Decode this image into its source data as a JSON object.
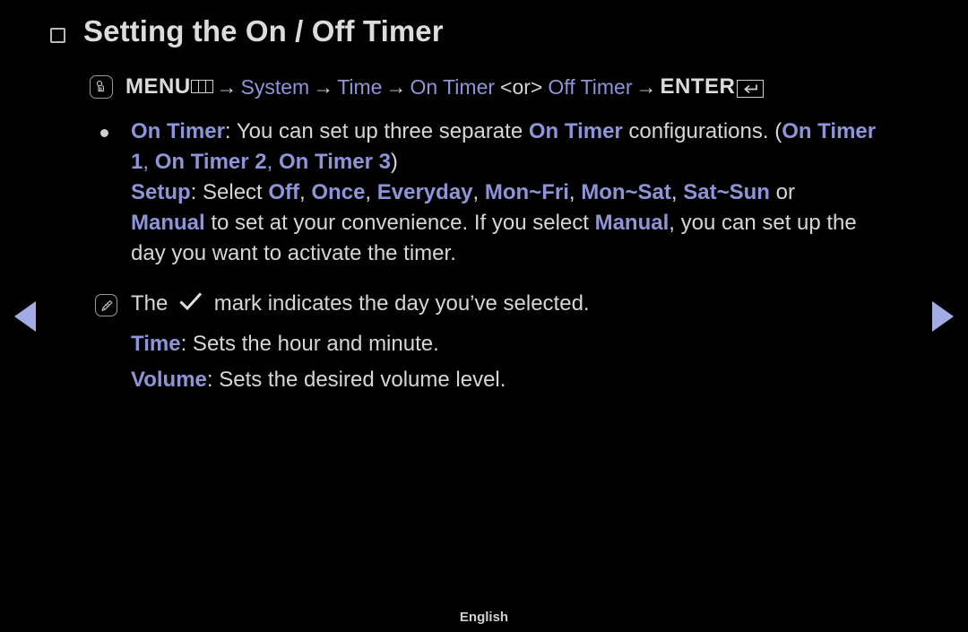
{
  "page": {
    "title": "Setting the On / Off Timer",
    "title_bullet_icon": "square-bullet-icon",
    "background_color": "#000000",
    "accent_color": "#8e94d8",
    "text_color": "#d6d6d6",
    "nav_arrow_color": "#a3abe4"
  },
  "breadcrumb": {
    "menu_icon": "hand-press-icon",
    "menu_label": "MENU",
    "arrow": "→",
    "items": [
      "System",
      "Time",
      "On Timer",
      "Off Timer"
    ],
    "or_label": "<or>",
    "enter_label": "ENTER",
    "enter_icon": "return-key-icon"
  },
  "bullet": {
    "marker": "●",
    "line1": {
      "term": "On Timer",
      "text_a": ": You can set up three separate ",
      "term2": "On Timer",
      "text_b": " configurations. (",
      "term3": "On Timer"
    },
    "line2": {
      "term_a": "1",
      "sep_a": ", ",
      "term_b": "On Timer 2",
      "sep_b": ", ",
      "term_c": "On Timer 3",
      "close": ")"
    }
  },
  "setup": {
    "term": "Setup",
    "lead": ": Select ",
    "options": [
      "Off",
      "Once",
      "Everyday",
      "Mon~Fri",
      "Mon~Sat",
      "Sat~Sun"
    ],
    "separator": ", ",
    "trailing": " or",
    "line2_term": "Manual",
    "line2_text_a": " to set at your convenience. If you select ",
    "line2_term2": "Manual",
    "line2_text_b": ", you can set up the",
    "line3": "day you want to activate the timer."
  },
  "note": {
    "icon": "note-pen-icon",
    "text_a": "The",
    "check_icon": "checkmark-icon",
    "text_b": "mark indicates the day you’ve selected."
  },
  "definitions": [
    {
      "term": "Time",
      "text": ": Sets the hour and minute."
    },
    {
      "term": "Volume",
      "text": ": Sets the desired volume level."
    }
  ],
  "navigation": {
    "prev_icon": "left-triangle-icon",
    "next_icon": "right-triangle-icon"
  },
  "footer": {
    "language": "English"
  }
}
